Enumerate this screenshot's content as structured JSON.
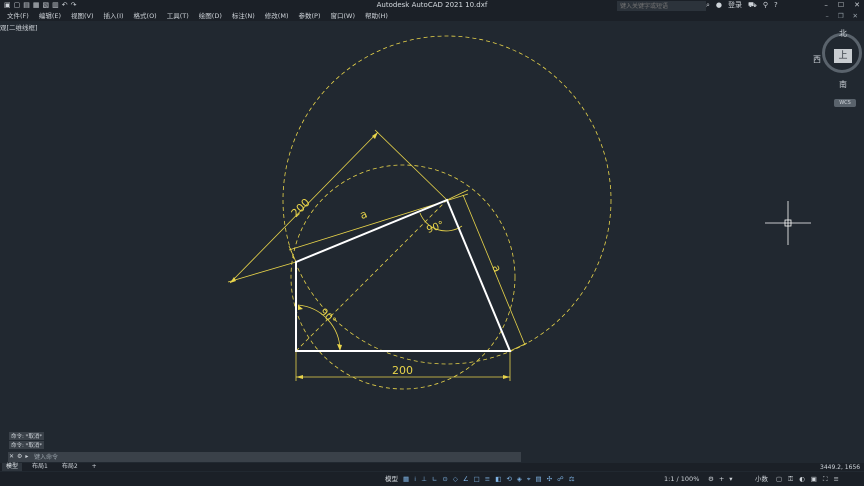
{
  "app": {
    "title": "Autodesk AutoCAD 2021    10.dxf",
    "search_placeholder": "键入关键字或短语",
    "sign_in": "登录"
  },
  "menu": [
    "文件(F)",
    "编辑(E)",
    "视图(V)",
    "插入(I)",
    "格式(O)",
    "工具(T)",
    "绘图(D)",
    "标注(N)",
    "修改(M)",
    "参数(P)",
    "窗口(W)",
    "帮助(H)"
  ],
  "viewport_label": "观[二维线框]",
  "viewcube": {
    "north": "北",
    "west": "西",
    "south": "南",
    "top": "上",
    "wcs": "WCS"
  },
  "drawing_labels": {
    "side_a_top": "a",
    "side_a_right": "a",
    "dim_200_left": "200",
    "dim_200_bottom": "200",
    "angle_top": "90°",
    "angle_left": "90°"
  },
  "command": {
    "history": [
      "命令: *取消*",
      "命令: *取消*"
    ],
    "placeholder": "键入命令"
  },
  "layout_tabs": [
    "模型",
    "布局1",
    "布局2",
    "+"
  ],
  "coordinates": "3449.2, 1656",
  "status": {
    "model": "模型",
    "scale": "1:1 / 100%",
    "units": "小数"
  },
  "colors": {
    "background": "#212830",
    "construction": "#e8d44a",
    "geometry": "#ffffff"
  }
}
